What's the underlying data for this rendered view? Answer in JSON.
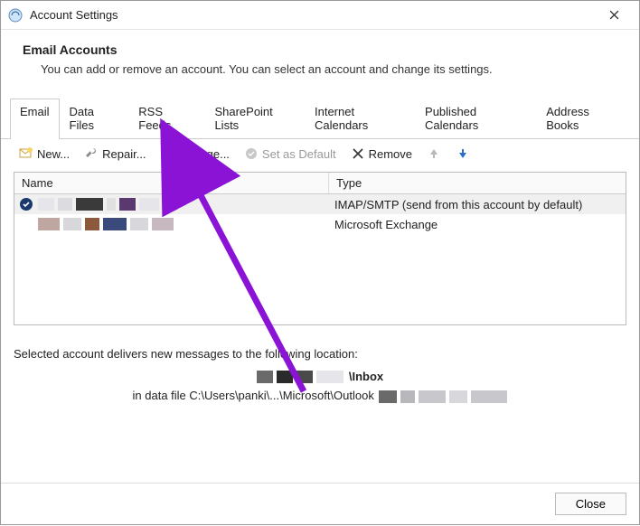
{
  "window": {
    "title": "Account Settings"
  },
  "header": {
    "heading": "Email Accounts",
    "description": "You can add or remove an account. You can select an account and change its settings."
  },
  "tabs": [
    {
      "label": "Email",
      "active": true
    },
    {
      "label": "Data Files",
      "active": false
    },
    {
      "label": "RSS Feeds",
      "active": false
    },
    {
      "label": "SharePoint Lists",
      "active": false
    },
    {
      "label": "Internet Calendars",
      "active": false
    },
    {
      "label": "Published Calendars",
      "active": false
    },
    {
      "label": "Address Books",
      "active": false
    }
  ],
  "toolbar": {
    "new_label": "New...",
    "repair_label": "Repair...",
    "change_label": "Change...",
    "default_label": "Set as Default",
    "remove_label": "Remove"
  },
  "columns": {
    "name": "Name",
    "type": "Type"
  },
  "rows": [
    {
      "default": true,
      "name_redacted": true,
      "type": "IMAP/SMTP (send from this account by default)"
    },
    {
      "default": false,
      "name_redacted": true,
      "type": "Microsoft Exchange"
    }
  ],
  "location": {
    "intro": "Selected account delivers new messages to the following location:",
    "folder_suffix": "\\Inbox",
    "path_prefix": "in data file C:\\Users\\panki\\...\\Microsoft\\Outlook"
  },
  "footer": {
    "close_label": "Close"
  }
}
